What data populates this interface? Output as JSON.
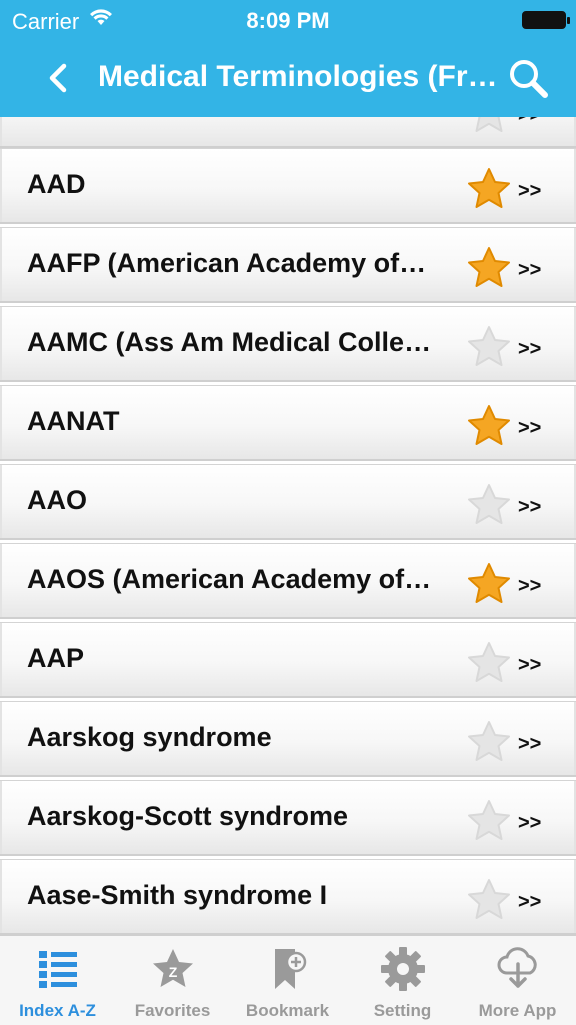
{
  "status_bar": {
    "carrier": "Carrier",
    "time": "8:09 PM"
  },
  "nav": {
    "title": "Medical Terminologies (Fr…",
    "back_icon": "chevron-left-icon",
    "search_icon": "search-icon"
  },
  "colors": {
    "header": "#33b4e6",
    "star_on": "#f5a623",
    "star_off": "#e5e5e5",
    "tab_active": "#2d8fdd",
    "tab_inactive": "#9a9a9a"
  },
  "list": {
    "chevron_text": ">>",
    "items": [
      {
        "label": "",
        "favorite": false
      },
      {
        "label": "AAD",
        "favorite": true
      },
      {
        "label": "AAFP (American Academy of…",
        "favorite": true
      },
      {
        "label": "AAMC (Ass Am Medical Colle…",
        "favorite": false
      },
      {
        "label": "AANAT",
        "favorite": true
      },
      {
        "label": "AAO",
        "favorite": false
      },
      {
        "label": "AAOS (American Academy of…",
        "favorite": true
      },
      {
        "label": "AAP",
        "favorite": false
      },
      {
        "label": "Aarskog syndrome",
        "favorite": false
      },
      {
        "label": "Aarskog-Scott syndrome",
        "favorite": false
      },
      {
        "label": "Aase-Smith syndrome I",
        "favorite": false
      }
    ]
  },
  "tabs": [
    {
      "label": "Index A-Z",
      "icon": "list-icon",
      "active": true
    },
    {
      "label": "Favorites",
      "icon": "star-z-icon",
      "active": false
    },
    {
      "label": "Bookmark",
      "icon": "bookmark-plus-icon",
      "active": false
    },
    {
      "label": "Setting",
      "icon": "gear-icon",
      "active": false
    },
    {
      "label": "More App",
      "icon": "cloud-download-icon",
      "active": false
    }
  ]
}
